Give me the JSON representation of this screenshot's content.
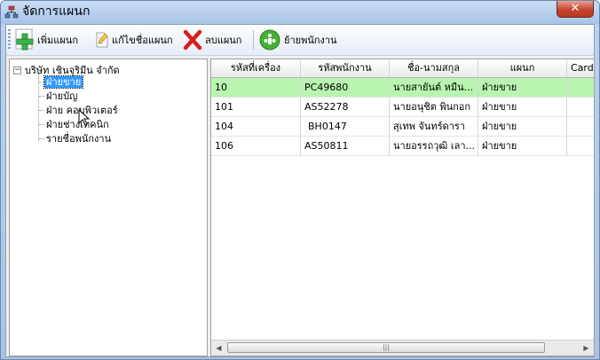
{
  "window": {
    "title": "จัดการแผนก",
    "close_glyph": "✕"
  },
  "toolbar": {
    "add_label": "เพิ่มแผนก",
    "edit_label": "แก้ไขชื่อแผนก",
    "delete_label": "ลบแผนก",
    "move_label": "ย้ายพนักงาน"
  },
  "tree": {
    "root_label": "บริษัท เชินจุริมีน จำกัด",
    "expander": "−",
    "nodes": [
      {
        "label": "ฝ่ายขาย"
      },
      {
        "label": "ฝ่ายบัญ"
      },
      {
        "label": "ฝ่าย คอมพิวเตอร์"
      },
      {
        "label": "ฝ่ายช่างเทคนิก"
      },
      {
        "label": "รายชื่อพนักงาน"
      }
    ]
  },
  "grid": {
    "columns": [
      "รหัสที่เครื่อง",
      "รหัสพนักงาน",
      "ชื่อ-นามสกุล",
      "แผนก",
      "Card N"
    ],
    "rows": [
      [
        "10",
        "PC49680",
        "นายสายันต์ หมืน...",
        "ฝ่ายขาย",
        ""
      ],
      [
        "101",
        "AS52278",
        "นายอนุชิต พินกอก",
        "ฝ่ายขาย",
        ""
      ],
      [
        "104",
        "BH0147",
        "สุเทพ จันทร์ดารา",
        "ฝ่ายขาย",
        ""
      ],
      [
        "106",
        "AS50811",
        "นายอรรถวุฒิ เลา...",
        "ฝ่ายขาย",
        ""
      ]
    ],
    "scroll_left": "◀",
    "scroll_right": "▶",
    "thumb_grip": "|||"
  },
  "colors": {
    "selected_row": "#b9f5b1",
    "selected_node": "#3399ff"
  }
}
